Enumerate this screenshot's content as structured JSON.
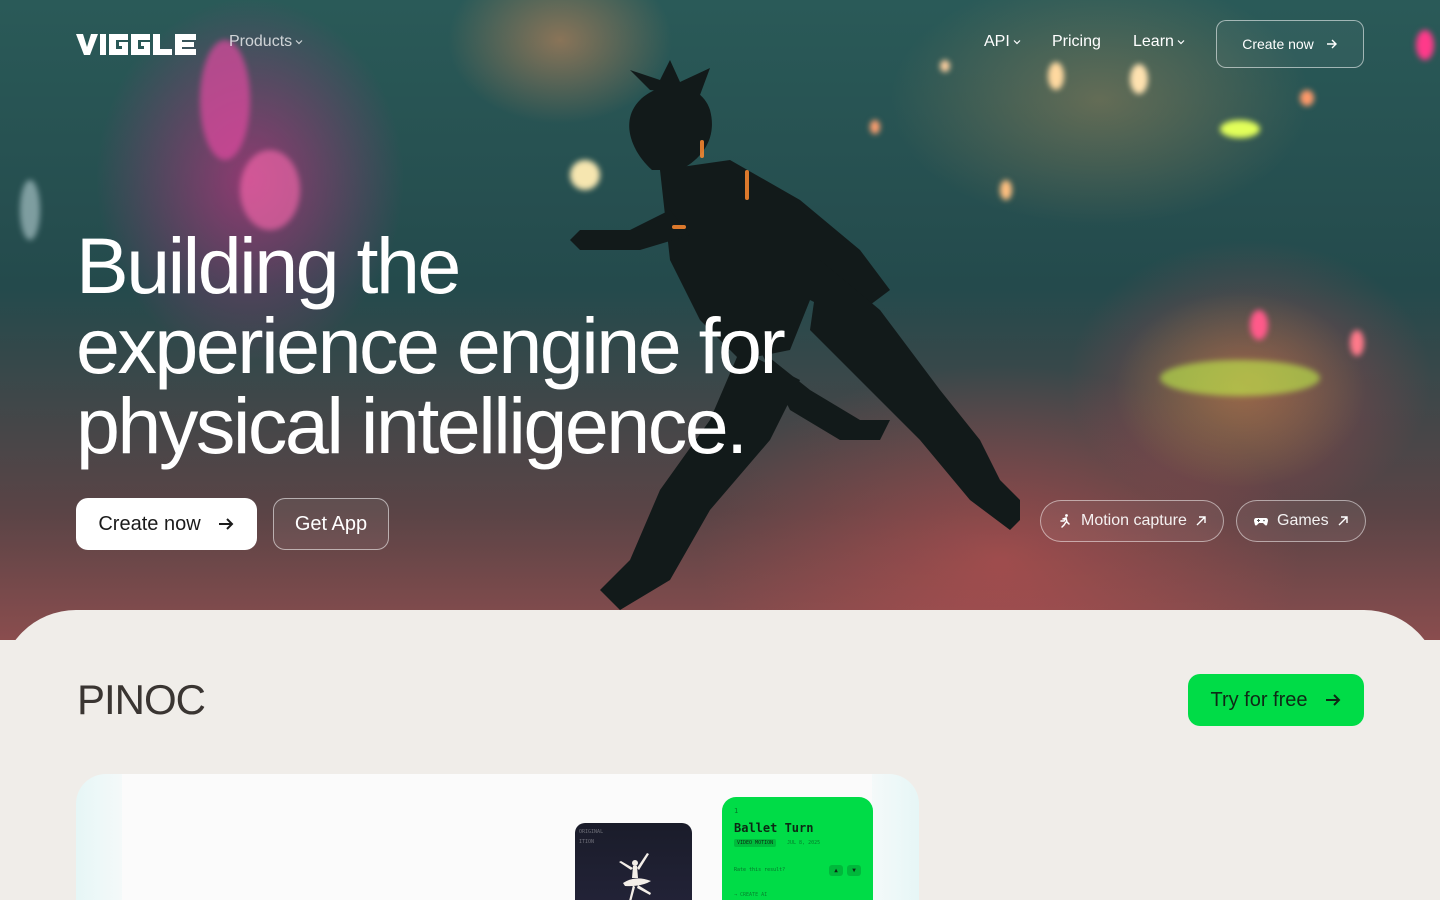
{
  "nav": {
    "logo_text": "VIGGLE",
    "products_label": "Products",
    "api_label": "API",
    "pricing_label": "Pricing",
    "learn_label": "Learn",
    "cta_label": "Create now"
  },
  "hero": {
    "headline_line1": "Building the",
    "headline_line2": "experience engine for",
    "headline_line3": "physical intelligence.",
    "primary_button": "Create now",
    "secondary_button": "Get App",
    "pill_motion": "Motion capture",
    "pill_games": "Games"
  },
  "section": {
    "title": "PINOC",
    "try_button": "Try for free"
  },
  "preview_card": {
    "thumb_caption1": "ORIGINAL",
    "thumb_caption2": "ITION",
    "index": "1",
    "clip_title": "Ballet Turn",
    "tag": "VIDEO MOTION",
    "date": "JUL 8, 2025",
    "question": "Rate this result?",
    "footer": "→ CREATE AI"
  },
  "colors": {
    "accent_green": "#00dc47",
    "panel_bg": "#f0ede9",
    "text_dark": "#3a3532"
  }
}
